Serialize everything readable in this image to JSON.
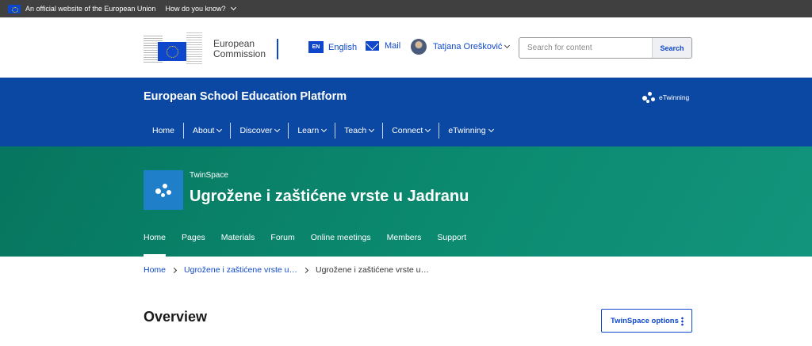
{
  "topbar": {
    "official_text": "An official website of the European Union",
    "how_label": "How do you know?"
  },
  "header": {
    "logo_line1": "European",
    "logo_line2": "Commission",
    "lang_code": "EN",
    "lang_label": "English",
    "mail_label": "Mail",
    "user_name": "Tatjana Orešković",
    "search_placeholder": "Search for content",
    "search_button": "Search"
  },
  "platform": {
    "title": "European School Education Platform",
    "etwinning_label": "eTwinning",
    "nav": [
      "Home",
      "About",
      "Discover",
      "Learn",
      "Teach",
      "Connect",
      "eTwinning"
    ]
  },
  "twinspace": {
    "kicker": "TwinSpace",
    "title": "Ugrožene i zaštićene vrste u Jadranu",
    "tabs": [
      "Home",
      "Pages",
      "Materials",
      "Forum",
      "Online meetings",
      "Members",
      "Support"
    ],
    "active_tab": "Home"
  },
  "breadcrumb": [
    "Home",
    "Ugrožene i zaštićene vrste u…",
    "Ugrožene i zaštićene vrste u…"
  ],
  "main": {
    "heading": "Overview",
    "options_button": "TwinSpace options"
  },
  "colors": {
    "eu_blue": "#0e47cb",
    "platform_blue": "#0b48a3",
    "twinspace_green": "#0b8a6f"
  }
}
